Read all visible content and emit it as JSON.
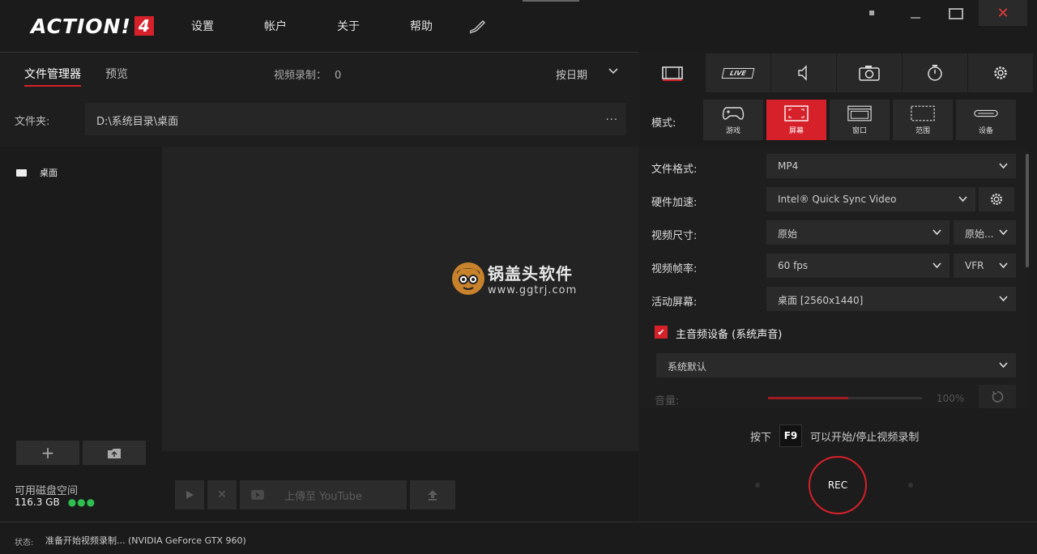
{
  "app": {
    "logo_text": "ACTION!",
    "logo_num": "4"
  },
  "menu": [
    "设置",
    "帐户",
    "关于",
    "帮助"
  ],
  "left": {
    "tabs": [
      {
        "label": "文件管理器",
        "active": true
      },
      {
        "label": "预览",
        "active": false
      }
    ],
    "rec_label": "视频录制：",
    "rec_count": "0",
    "sort_label": "按日期",
    "folder_label": "文件夹:",
    "folder_path": "D:\\系统目录\\桌面",
    "folder_more": "...",
    "tree_item": "桌面",
    "disk_label": "可用磁盘空间",
    "disk_value": "116.3 GB",
    "disk_dots": "●●●",
    "upload_label": "上傳至 YouTube"
  },
  "watermark": {
    "title": "锅盖头软件",
    "url": "www.ggtrj.com"
  },
  "right": {
    "live_label": "LIVE",
    "mode_label": "模式:",
    "modes": [
      {
        "label": "游戏",
        "active": false
      },
      {
        "label": "屏幕",
        "active": true
      },
      {
        "label": "窗口",
        "active": false
      },
      {
        "label": "范围",
        "active": false
      },
      {
        "label": "设备",
        "active": false
      }
    ],
    "rows": {
      "format_label": "文件格式:",
      "format_value": "MP4",
      "hw_label": "硬件加速:",
      "hw_value": "Intel® Quick Sync Video",
      "size_label": "视频尺寸:",
      "size_value": "原始",
      "size_value2": "原始...",
      "fps_label": "视频帧率:",
      "fps_value": "60 fps",
      "fps_mode": "VFR",
      "screen_label": "活动屏幕:",
      "screen_value": "桌面 [2560x1440]"
    },
    "audio_label": "主音频设备 (系统声音)",
    "audio_check": "✔",
    "audio_device": "系统默认",
    "volume_label": "音量:",
    "volume_pct": "100%",
    "volume_level": 0.52,
    "hotkey_pre": "按下",
    "hotkey": "F9",
    "hotkey_post": "可以开始/停止视频录制",
    "rec": "REC"
  },
  "status": {
    "label": "状态:",
    "text": "准备开始视频录制... (NVIDIA GeForce GTX 960)"
  },
  "colors": {
    "accent": "#d6202a",
    "disk_ok": "#2fbf4f"
  }
}
